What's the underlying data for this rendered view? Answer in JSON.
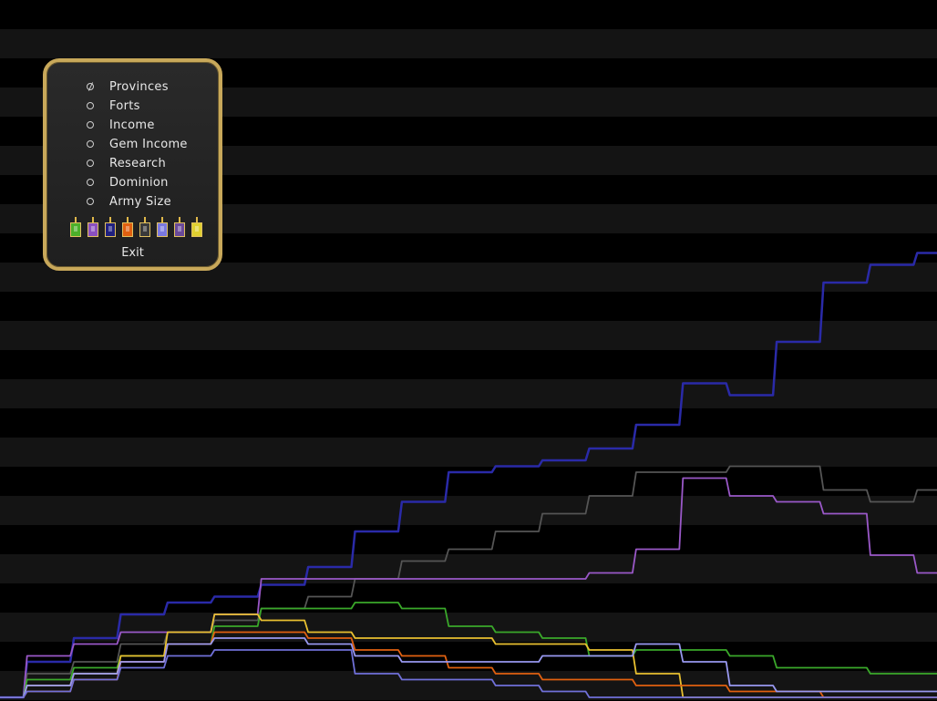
{
  "menu": {
    "options": [
      {
        "label": "Provinces",
        "selected": true
      },
      {
        "label": "Forts",
        "selected": false
      },
      {
        "label": "Income",
        "selected": false
      },
      {
        "label": "Gem Income",
        "selected": false
      },
      {
        "label": "Research",
        "selected": false
      },
      {
        "label": "Dominion",
        "selected": false
      },
      {
        "label": "Army Size",
        "selected": false
      }
    ],
    "banners": [
      {
        "name": "nation-banner-1",
        "color": "#4caf2a"
      },
      {
        "name": "nation-banner-2",
        "color": "#8a4fc0"
      },
      {
        "name": "nation-banner-3",
        "color": "#202080"
      },
      {
        "name": "nation-banner-4",
        "color": "#e06010"
      },
      {
        "name": "nation-banner-5",
        "color": "#3a3a3a"
      },
      {
        "name": "nation-banner-6",
        "color": "#7a78e0"
      },
      {
        "name": "nation-banner-7",
        "color": "#6a4a9a"
      },
      {
        "name": "nation-banner-8",
        "color": "#e0d030"
      }
    ],
    "exit_label": "Exit"
  },
  "chart_data": {
    "type": "line",
    "background_bands": true,
    "x": [
      0,
      5,
      10,
      15,
      20,
      25,
      30,
      35,
      40,
      45,
      50,
      55,
      60,
      65,
      70,
      75,
      80,
      85,
      90,
      95,
      100
    ],
    "ylim": [
      0,
      100
    ],
    "series": [
      {
        "color": "#2a2aa8",
        "values": [
          0,
          6,
          10,
          14,
          16,
          17,
          19,
          22,
          28,
          33,
          38,
          39,
          40,
          42,
          46,
          53,
          51,
          60,
          70,
          73,
          75
        ]
      },
      {
        "color": "#555555",
        "values": [
          0,
          4,
          6,
          9,
          11,
          13,
          15,
          17,
          20,
          23,
          25,
          28,
          31,
          34,
          38,
          38,
          39,
          39,
          35,
          33,
          35
        ]
      },
      {
        "color": "#9a58c8",
        "values": [
          0,
          7,
          9,
          11,
          11,
          14,
          20,
          20,
          20,
          20,
          20,
          20,
          20,
          21,
          25,
          37,
          34,
          33,
          31,
          24,
          21
        ]
      },
      {
        "color": "#3aa82a",
        "values": [
          0,
          3,
          5,
          7,
          9,
          12,
          15,
          15,
          16,
          15,
          12,
          11,
          10,
          7,
          8,
          8,
          7,
          5,
          5,
          4,
          4
        ]
      },
      {
        "color": "#e8c030",
        "values": [
          0,
          2,
          4,
          7,
          11,
          14,
          13,
          11,
          10,
          10,
          10,
          9,
          9,
          8,
          4,
          0,
          0,
          0,
          0,
          0,
          0
        ]
      },
      {
        "color": "#e06010",
        "values": [
          0,
          1,
          3,
          6,
          9,
          11,
          11,
          10,
          8,
          7,
          5,
          4,
          3,
          3,
          2,
          2,
          1,
          1,
          0,
          0,
          0
        ]
      },
      {
        "color": "#9898f0",
        "values": [
          0,
          2,
          4,
          6,
          9,
          10,
          10,
          9,
          7,
          6,
          6,
          6,
          7,
          7,
          9,
          6,
          2,
          1,
          1,
          1,
          1
        ]
      },
      {
        "color": "#7070d8",
        "values": [
          0,
          1,
          3,
          5,
          7,
          8,
          8,
          8,
          4,
          3,
          3,
          2,
          1,
          0,
          0,
          0,
          0,
          0,
          0,
          0,
          0
        ]
      }
    ]
  }
}
